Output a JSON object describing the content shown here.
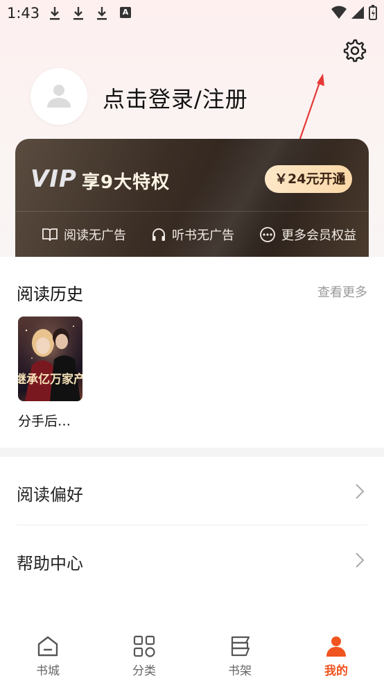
{
  "status_bar": {
    "time": "1:43",
    "notification_icons": [
      "download-icon",
      "download-icon",
      "download-icon",
      "a-icon"
    ],
    "right_icons": [
      "wifi-icon",
      "signal-icon",
      "battery-icon"
    ]
  },
  "header": {
    "settings_icon": "gear-icon"
  },
  "profile": {
    "login_text": "点击登录/注册"
  },
  "vip": {
    "logo": "VIP",
    "title": "享9大特权",
    "button_label": "￥24元开通",
    "benefits": [
      {
        "icon": "book-icon",
        "label": "阅读无广告"
      },
      {
        "icon": "headphones-icon",
        "label": "听书无广告"
      },
      {
        "icon": "more-icon",
        "label": "更多会员权益"
      }
    ]
  },
  "history": {
    "title": "阅读历史",
    "more_label": "查看更多",
    "books": [
      {
        "title": "分手后…",
        "cover_text": "继承亿万家产"
      }
    ]
  },
  "menu": [
    {
      "label": "阅读偏好"
    },
    {
      "label": "帮助中心"
    }
  ],
  "tabbar": {
    "tabs": [
      {
        "label": "书城",
        "icon": "home-icon",
        "active": false
      },
      {
        "label": "分类",
        "icon": "category-icon",
        "active": false
      },
      {
        "label": "书架",
        "icon": "bookshelf-icon",
        "active": false
      },
      {
        "label": "我的",
        "icon": "profile-icon",
        "active": true
      }
    ]
  },
  "colors": {
    "accent": "#f0541f",
    "vip_gold": "#fbd8a8",
    "annotation_arrow": "#e53935"
  }
}
